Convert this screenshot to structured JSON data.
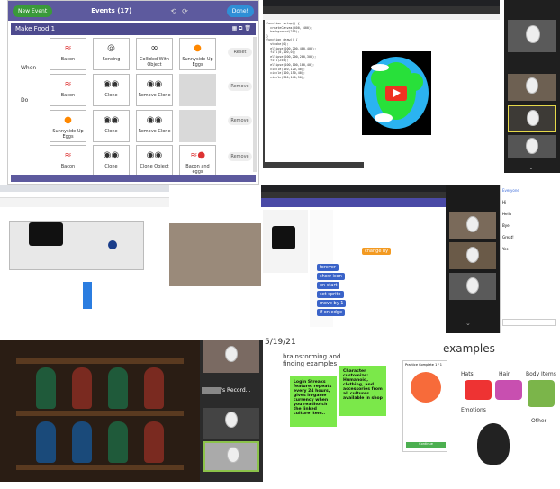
{
  "p1": {
    "new_event": "New Event",
    "title": "Events (17)",
    "done": "Done!",
    "make": "Make Food 1",
    "when": "When",
    "do": "Do",
    "rows": [
      {
        "cards": [
          "Bacon",
          "Sensing",
          "Collided With Object",
          "Sunnyside Up Eggs"
        ],
        "btn": "Reset"
      },
      {
        "cards": [
          "Bacon",
          "Clone",
          "Remove Clone",
          ""
        ],
        "btn": "Remove"
      },
      {
        "cards": [
          "Sunnyside Up Eggs",
          "Clone",
          "Remove Clone",
          ""
        ],
        "btn": "Remove"
      },
      {
        "cards": [
          "Bacon",
          "Clone",
          "Clone Object",
          "Bacon and eggs"
        ],
        "btn": "Remove"
      }
    ]
  },
  "p2": {
    "code": [
      "function setup() {",
      "  createCanvas(400, 400);",
      "  background(255);",
      "}",
      "",
      "function draw() {",
      "",
      "  stroke(0);",
      "  ellipse(200,200,400,400);",
      "",
      "  fill(0,100,0);",
      "  ellipse(200,200,200,300);",
      "  fill(255);",
      "  ellipse(100,100,100,40);",
      "  circle(150,120,40);",
      "  circle(100,150,40);",
      "  circle(300,140,50);"
    ]
  },
  "p4": {
    "blocks": [
      "forever",
      "show icon",
      "on start",
      "set sprite",
      "move by 1",
      "if on edge",
      "change by"
    ],
    "chat": [
      "Everyone",
      "Hi",
      "Hello",
      "Bye",
      "Great!",
      "Yes"
    ]
  },
  "p5": {
    "recording": "'s Record..."
  },
  "p6": {
    "date": "5/19/21",
    "examples": "examples",
    "brainstorm": "brainstorming and finding examples",
    "sticky1": "Login Streaks feature: repeats every 24 hours, gives in-game currency when you readhotch the linked culture item..",
    "sticky2": "Character customize: Humanoid, clothing, and accessories from all cultures available in shop",
    "labels": [
      "Hats",
      "Hair",
      "Body Items",
      "Emotions",
      "Other"
    ],
    "app_title": "Practice Complete 1 / 1",
    "app_btn": "Continue"
  }
}
